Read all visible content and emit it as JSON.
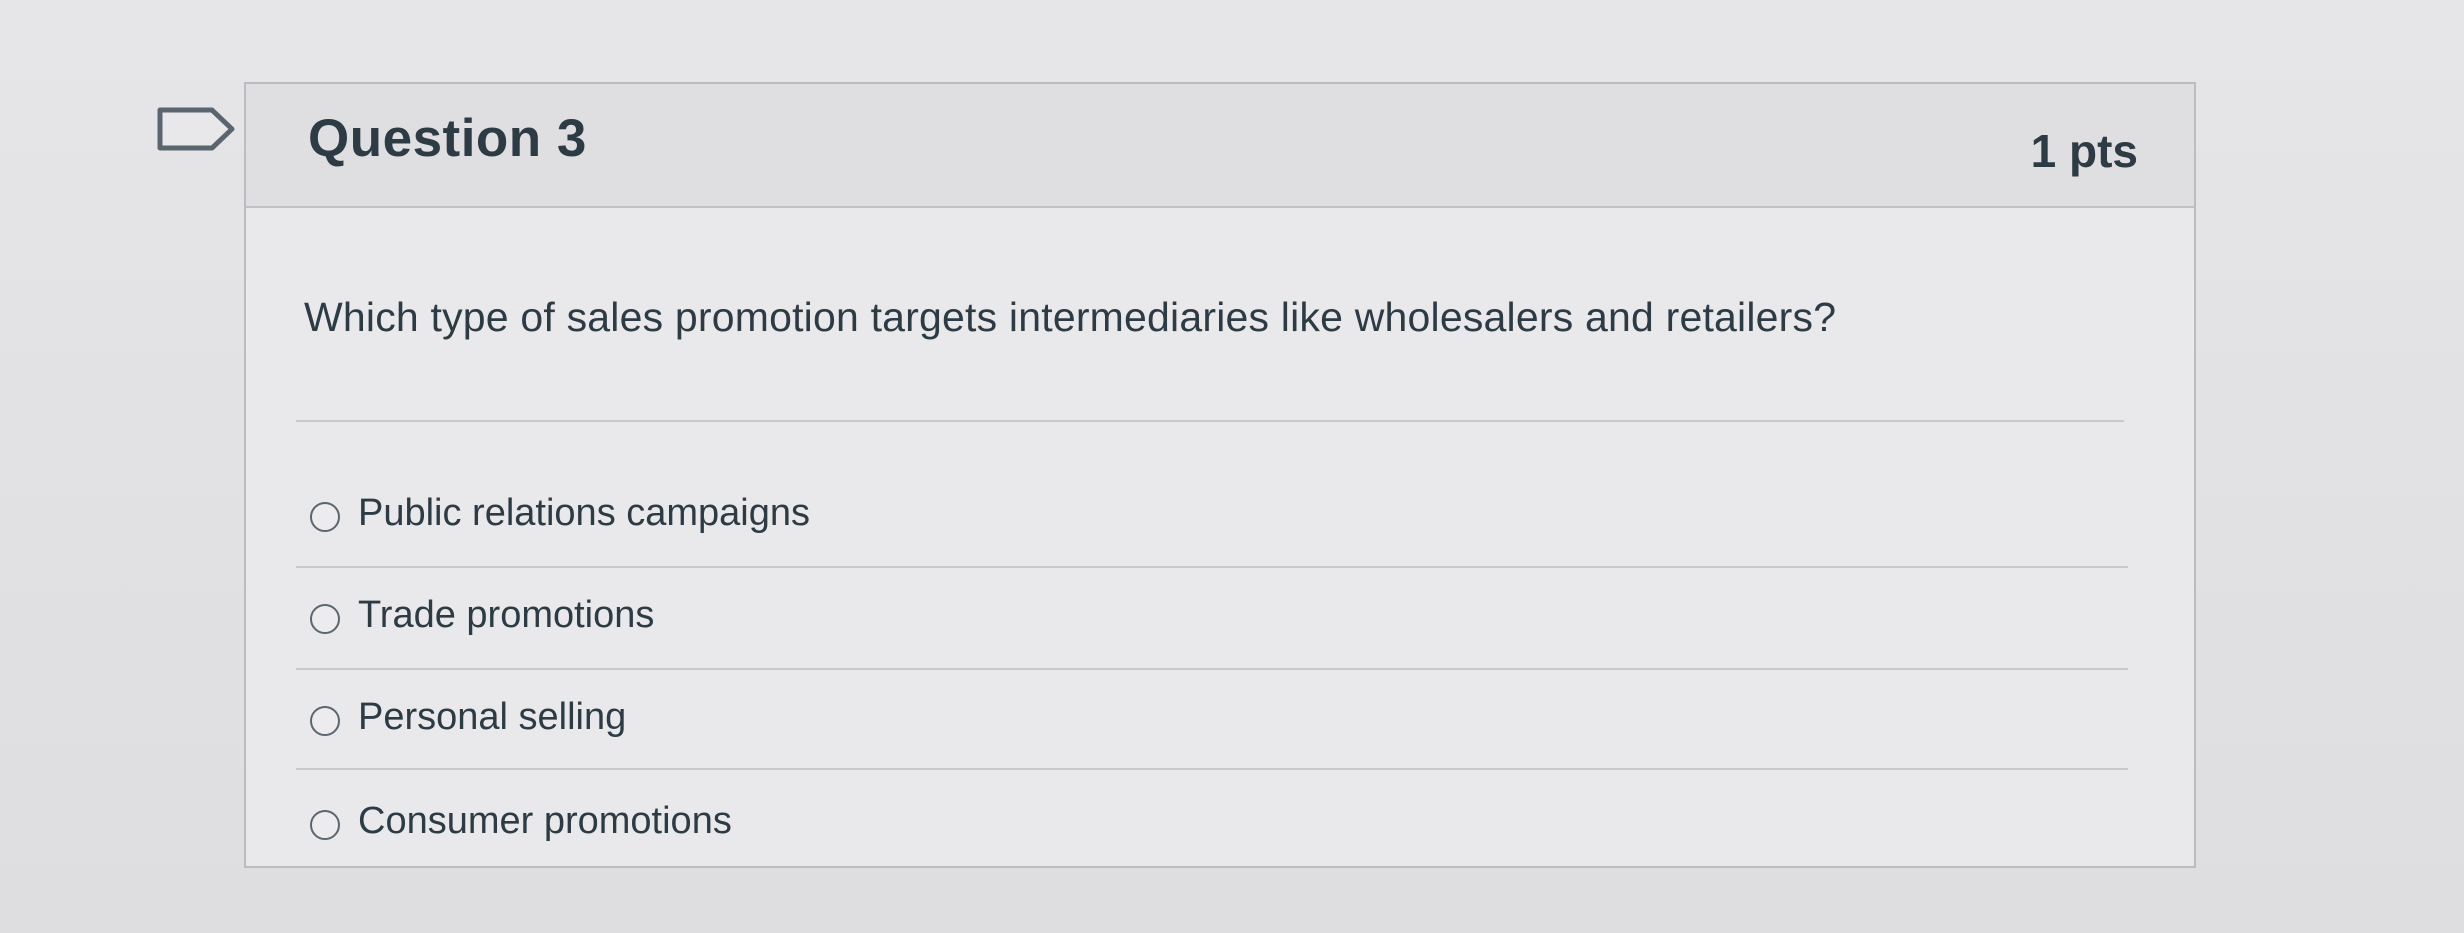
{
  "question": {
    "title": "Question 3",
    "points": "1 pts",
    "text": "Which type of sales promotion targets intermediaries like wholesalers and retailers?",
    "flag_icon": "flag-outline-icon"
  },
  "answers": [
    {
      "label": "Public relations campaigns",
      "selected": false
    },
    {
      "label": "Trade promotions",
      "selected": false
    },
    {
      "label": "Personal selling",
      "selected": false
    },
    {
      "label": "Consumer promotions",
      "selected": false
    }
  ]
}
